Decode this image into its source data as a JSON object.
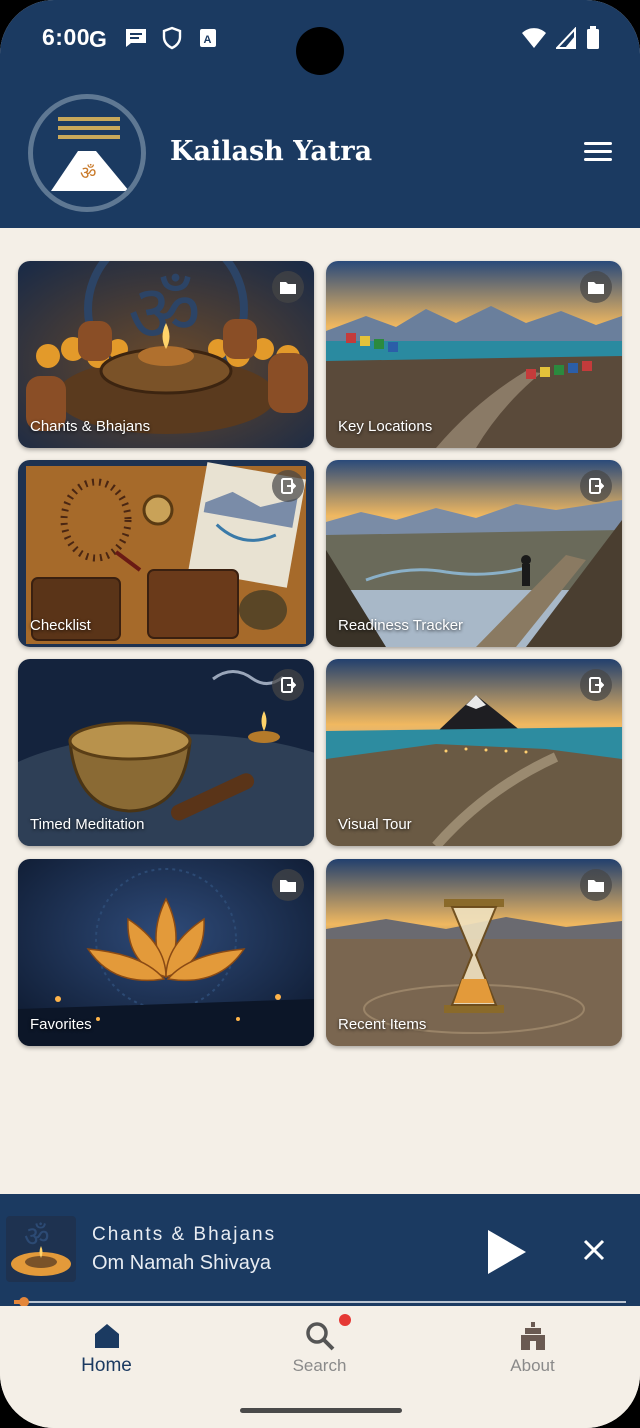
{
  "status": {
    "time": "6:00"
  },
  "header": {
    "title": "Kailash Yatra"
  },
  "tiles": [
    {
      "label": "Chants & Bhajans",
      "badge": "folder-icon"
    },
    {
      "label": "Key Locations",
      "badge": "folder-icon"
    },
    {
      "label": "Checklist",
      "badge": "open-page-icon"
    },
    {
      "label": "Readiness Tracker",
      "badge": "open-page-icon"
    },
    {
      "label": "Timed Meditation",
      "badge": "open-page-icon"
    },
    {
      "label": "Visual Tour",
      "badge": "open-page-icon"
    },
    {
      "label": "Favorites",
      "badge": "folder-icon"
    },
    {
      "label": "Recent Items",
      "badge": "folder-icon"
    }
  ],
  "player": {
    "category": "Chants & Bhajans",
    "title": "Om Namah Shivaya",
    "progress": 0.016
  },
  "nav": {
    "items": [
      {
        "label": "Home",
        "icon": "home-icon",
        "active": true
      },
      {
        "label": "Search",
        "icon": "search-icon",
        "active": false,
        "badge": true
      },
      {
        "label": "About",
        "icon": "temple-icon",
        "active": false
      }
    ]
  },
  "colors": {
    "primary": "#1b3a61",
    "background": "#f4efe7",
    "accent": "#e3863a",
    "badge": "#e53935"
  }
}
